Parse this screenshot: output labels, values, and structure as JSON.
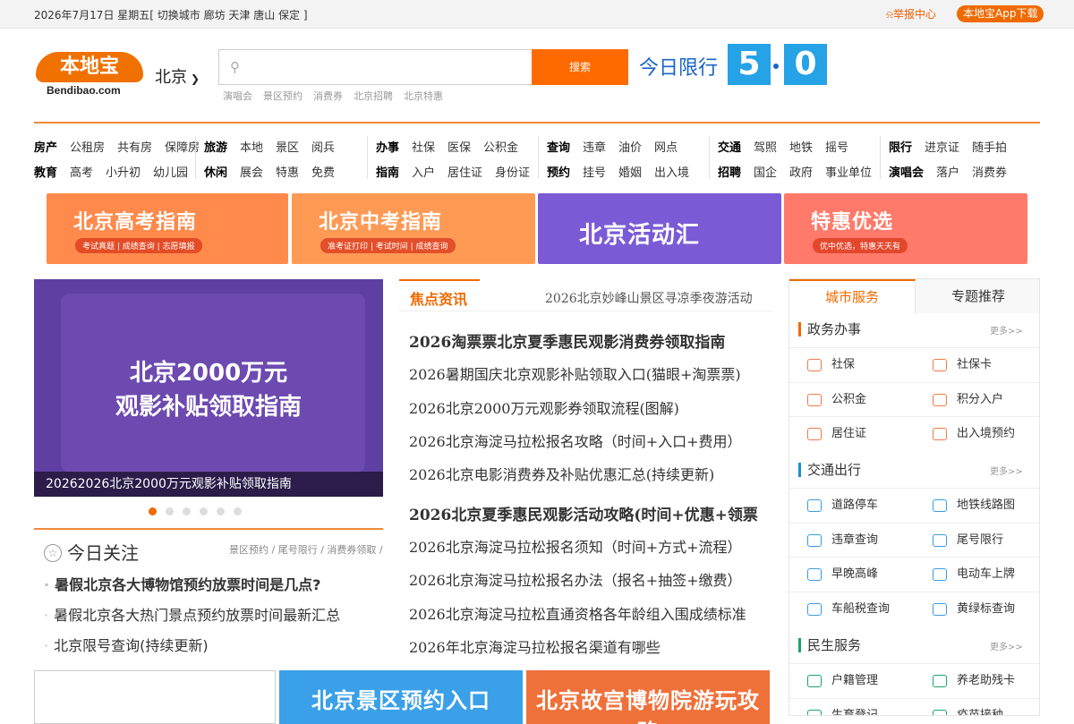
{
  "topbar": {
    "date_text": "2026年7月17日 星期五[ 切换城市 廊坊 天津 唐山 保定 ]",
    "report": "举报中心",
    "app_download": "本地宝App下载"
  },
  "header": {
    "logo_cn": "本地宝",
    "logo_en": "Bendibao.com",
    "city": "北京",
    "search_placeholder": "",
    "search_button": "搜索",
    "hot_words": [
      "演唱会",
      "景区预约",
      "消费券",
      "北京招聘",
      "北京特惠"
    ],
    "limit_label": "今日限行",
    "limit_digits": [
      "5",
      "0"
    ]
  },
  "nav": [
    {
      "rows": [
        [
          {
            "t": "房产",
            "b": true
          },
          {
            "t": "公租房"
          },
          {
            "t": "共有房"
          },
          {
            "t": "保障房"
          }
        ],
        [
          {
            "t": "教育",
            "b": true
          },
          {
            "t": "高考"
          },
          {
            "t": "小升初"
          },
          {
            "t": "幼儿园"
          }
        ]
      ]
    },
    {
      "rows": [
        [
          {
            "t": "旅游",
            "b": true
          },
          {
            "t": "本地"
          },
          {
            "t": "景区"
          },
          {
            "t": "阅兵"
          }
        ],
        [
          {
            "t": "休闲",
            "b": true
          },
          {
            "t": "展会"
          },
          {
            "t": "特惠"
          },
          {
            "t": "免费"
          }
        ]
      ]
    },
    {
      "rows": [
        [
          {
            "t": "办事",
            "b": true
          },
          {
            "t": "社保"
          },
          {
            "t": "医保"
          },
          {
            "t": "公积金"
          }
        ],
        [
          {
            "t": "指南",
            "b": true
          },
          {
            "t": "入户"
          },
          {
            "t": "居住证"
          },
          {
            "t": "身份证"
          }
        ]
      ]
    },
    {
      "rows": [
        [
          {
            "t": "查询",
            "b": true
          },
          {
            "t": "违章"
          },
          {
            "t": "油价"
          },
          {
            "t": "网点"
          }
        ],
        [
          {
            "t": "预约",
            "b": true
          },
          {
            "t": "挂号"
          },
          {
            "t": "婚姻"
          },
          {
            "t": "出入境"
          }
        ]
      ]
    },
    {
      "rows": [
        [
          {
            "t": "交通",
            "b": true
          },
          {
            "t": "驾照"
          },
          {
            "t": "地铁"
          },
          {
            "t": "摇号"
          }
        ],
        [
          {
            "t": "招聘",
            "b": true
          },
          {
            "t": "国企"
          },
          {
            "t": "政府"
          },
          {
            "t": "事业单位"
          }
        ]
      ]
    },
    {
      "rows": [
        [
          {
            "t": "限行",
            "b": true
          },
          {
            "t": "进京证"
          },
          {
            "t": "随手拍"
          }
        ],
        [
          {
            "t": "演唱会",
            "b": true
          },
          {
            "t": "落户"
          },
          {
            "t": "消费券"
          }
        ]
      ]
    }
  ],
  "banners": [
    {
      "title": "北京高考指南",
      "sub": "考试真题 | 成绩查询 | 志愿填报",
      "color": "#ff8a4c"
    },
    {
      "title": "北京中考指南",
      "sub": "准考证打印 | 考试时间 | 成绩查询",
      "color": "#ff9a55"
    },
    {
      "title": "北京活动汇",
      "sub": "",
      "color": "#7b5ad6"
    },
    {
      "title": "特惠优选",
      "sub": "优中优选，特惠天天有",
      "color": "#ff7a6a"
    }
  ],
  "slider": {
    "line1": "北京2000万元",
    "line2": "观影补贴领取指南",
    "caption": "20262026北京2000万元观影补贴领取指南",
    "count": 6
  },
  "attention": {
    "title": "今日关注",
    "tags": "景区预约 / 尾号限行 / 消费券领取 /",
    "items": [
      "暑假北京各大博物馆预约放票时间是几点?",
      "暑假北京各大热门景点预约放票时间最新汇总",
      "北京限号查询(持续更新)"
    ]
  },
  "news": {
    "tab": "焦点资讯",
    "ticker": "2026北京妙峰山景区寻凉季夜游活动",
    "items": [
      {
        "t": "2026淘票票北京夏季惠民观影消费券领取指南",
        "h": true
      },
      {
        "t": "2026暑期国庆北京观影补贴领取入口(猫眼+淘票票)"
      },
      {
        "t": "2026北京2000万元观影券领取流程(图解)"
      },
      {
        "t": "2026北京海淀马拉松报名攻略（时间+入口+费用）"
      },
      {
        "t": "2026北京电影消费券及补贴优惠汇总(持续更新)"
      },
      {
        "t": "2026北京夏季惠民观影活动攻略(时间+优惠+领票",
        "h": true
      },
      {
        "t": "2026北京海淀马拉松报名须知（时间+方式+流程）"
      },
      {
        "t": "2026北京海淀马拉松报名办法（报名+抽签+缴费）"
      },
      {
        "t": "2026北京海淀马拉松直通资格各年龄组入围成绩标准"
      },
      {
        "t": "2026年北京海淀马拉松报名渠道有哪些"
      }
    ]
  },
  "services": {
    "tab_active": "城市服务",
    "tab_other": "专题推荐",
    "more": "更多>>",
    "groups": [
      {
        "title": "政务办事",
        "items": [
          "社保",
          "社保卡",
          "公积金",
          "积分入户",
          "居住证",
          "出入境预约"
        ]
      },
      {
        "title": "交通出行",
        "items": [
          "道路停车",
          "地铁线路图",
          "违章查询",
          "尾号限行",
          "早晚高峰",
          "电动车上牌",
          "车船税查询",
          "黄绿标查询"
        ]
      },
      {
        "title": "民生服务",
        "items": [
          "户籍管理",
          "养老助残卡",
          "生育登记",
          "疫苗接种"
        ]
      }
    ]
  },
  "bottom_banners": [
    {
      "title": "",
      "color": "#ffffff"
    },
    {
      "title": "北京景区预约入口",
      "color": "#3aa0e8"
    },
    {
      "title": "北京故宫博物院游玩攻略",
      "color": "#f0703a"
    }
  ]
}
